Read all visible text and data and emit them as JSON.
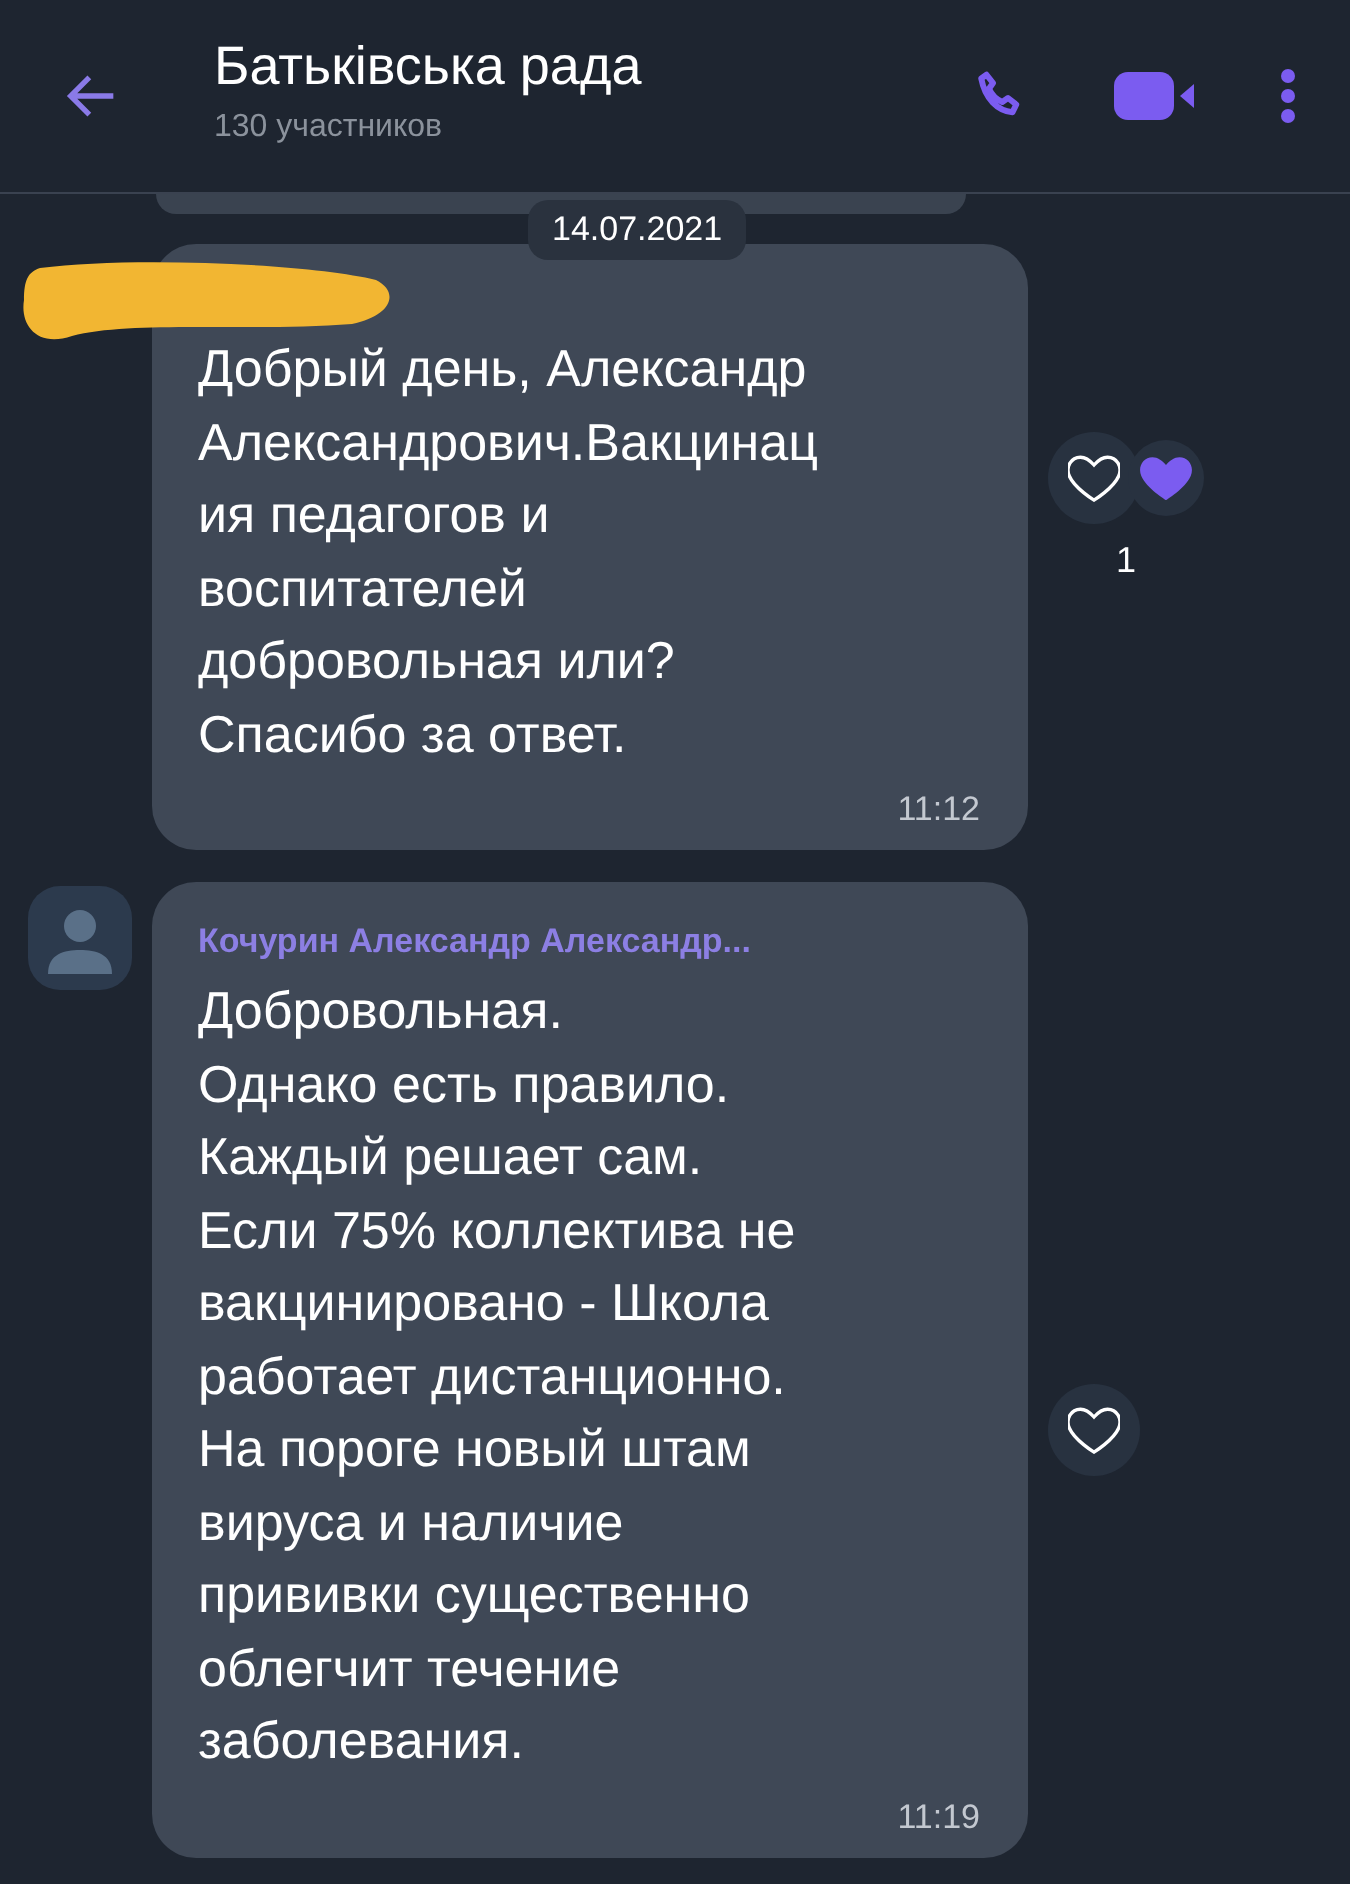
{
  "header": {
    "title": "Батьківська рада",
    "subtitle": "130 участников"
  },
  "date": "14.07.2021",
  "messages": [
    {
      "sender_redacted": true,
      "text": "Добрый день, Александр\nАлександрович.Вакцинац\nия педагогов и\nвоспитателей\nдобровольная или?\nСпасибо за ответ.",
      "time": "11:12",
      "reactions": [
        {
          "kind": "heart",
          "count": "1"
        }
      ]
    },
    {
      "sender_redacted": false,
      "sender": "Кочурин Александр Александр...",
      "text": "Добровольная.\nОднако есть правило.\nКаждый решает сам.\nЕсли 75% коллектива не\nвакцинировано - Школа\nработает дистанционно.\nНа пороге новый штам\nвируса и наличие\nпрививки существенно\nоблегчит течение\nзаболевания.",
      "time": "11:19"
    }
  ]
}
